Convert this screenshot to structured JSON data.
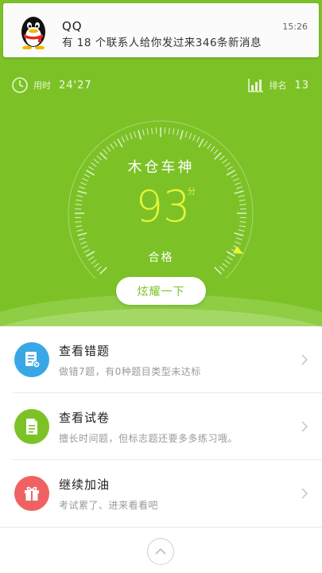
{
  "notification": {
    "app": "QQ",
    "time": "15:26",
    "message": "有 18 个联系人给你发过来346条新消息",
    "icon": "qq-penguin-icon"
  },
  "stats": {
    "time_label": "用时",
    "time_value": "24'27",
    "rank_label": "排名",
    "rank_value": "13"
  },
  "gauge": {
    "title": "木仓车神",
    "score": "93",
    "unit": "分",
    "grade": "合格"
  },
  "show_button": "炫耀一下",
  "list": [
    {
      "title": "查看错题",
      "subtitle": "做错7题，有0种题目类型未达标",
      "icon": "wrong-questions-icon",
      "color": "#39a7e6"
    },
    {
      "title": "查看试卷",
      "subtitle": "擅长时间题，但标志题还要多多练习哦。",
      "icon": "exam-paper-icon",
      "color": "#7cc227"
    },
    {
      "title": "继续加油",
      "subtitle": "考试累了、进来看看吧",
      "icon": "gift-icon",
      "color": "#f06262"
    }
  ],
  "colors": {
    "primary_green": "#7cc227",
    "score_yellow": "#e6f53a"
  }
}
